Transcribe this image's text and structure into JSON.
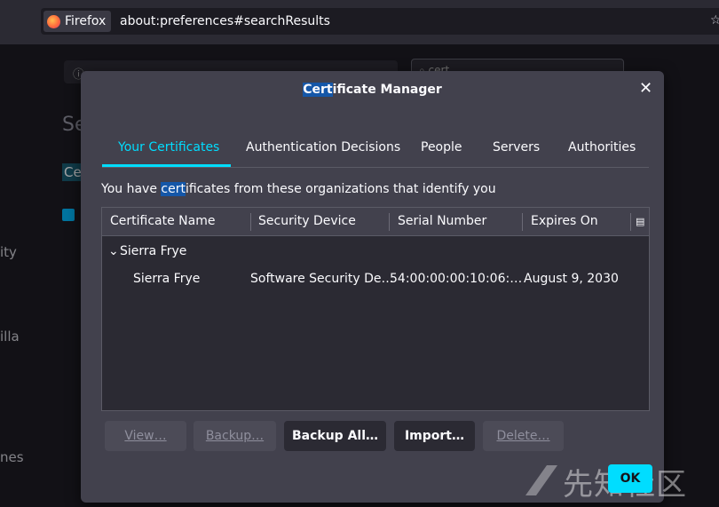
{
  "browser": {
    "identity_label": "Firefox",
    "url": "about:preferences#searchResults",
    "star_glyph": "☆"
  },
  "background": {
    "notice_icon": "ⓘ",
    "search_text": "cert",
    "section_prefix": "Se",
    "highlight_prefix": "Ce",
    "side_labels": [
      "ity",
      "illa",
      "nes"
    ]
  },
  "dialog": {
    "title_hl": "Cert",
    "title_rest": "ificate Manager",
    "tabs": [
      "Your Certificates",
      "Authentication Decisions",
      "People",
      "Servers",
      "Authorities"
    ],
    "description_pre": "You have ",
    "description_hl": "cert",
    "description_post": "ificates from these organizations that identify you",
    "columns": [
      "Certificate Name",
      "Security Device",
      "Serial Number",
      "Expires On"
    ],
    "group": {
      "label": "Sierra Frye",
      "rows": [
        {
          "name": "Sierra Frye",
          "device": "Software Security De…",
          "serial": "54:00:00:00:10:06:…",
          "expires": "August 9, 2030"
        }
      ]
    },
    "buttons": {
      "view": "View…",
      "backup": "Backup…",
      "backup_all": "Backup All…",
      "import": "Import…",
      "delete": "Delete…"
    },
    "ok": "OK"
  },
  "watermark": "先知社区",
  "colors": {
    "accent": "#00ddff",
    "dialog_bg": "#42414d",
    "tree_bg": "#2b2a33"
  }
}
